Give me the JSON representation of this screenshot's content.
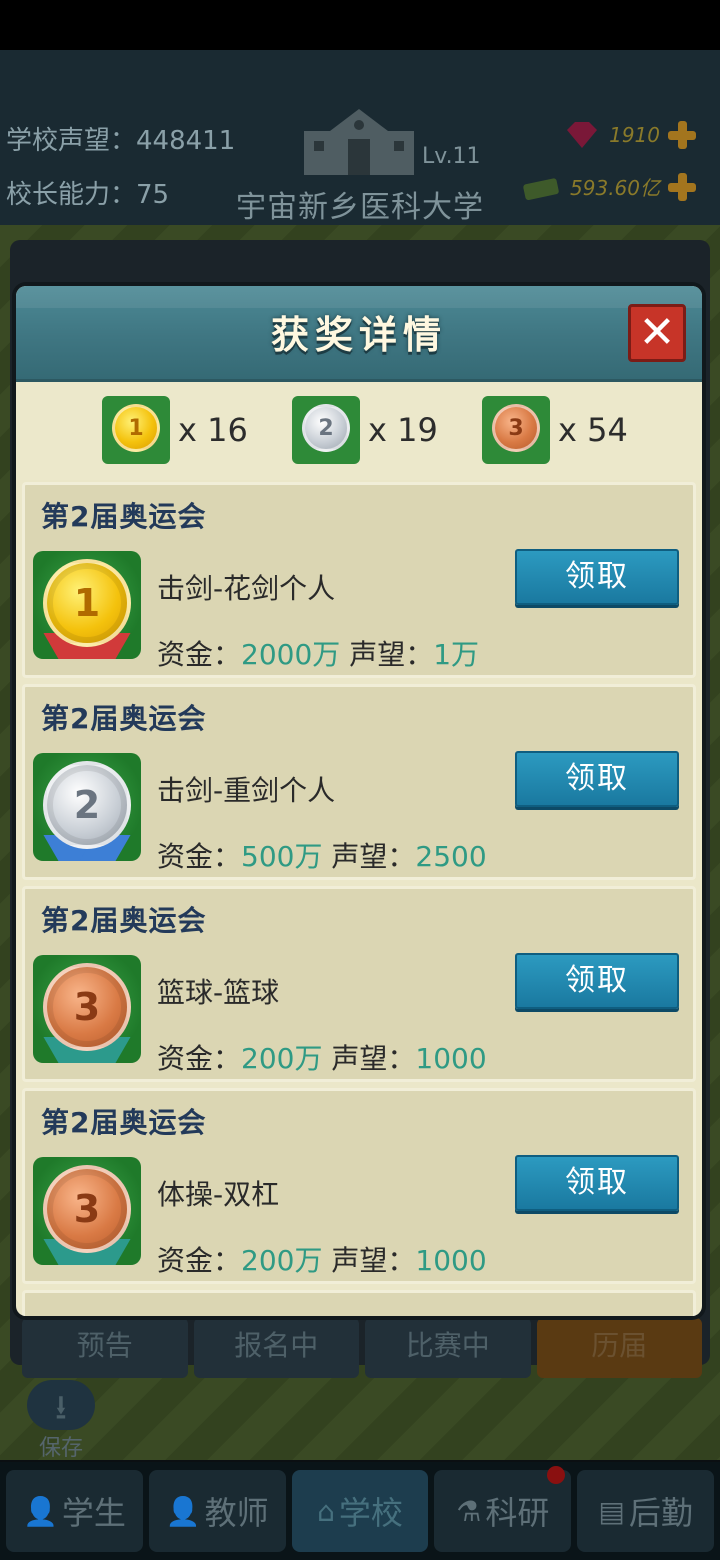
{
  "hud": {
    "reputation_label": "学校声望：",
    "reputation_value": "448411",
    "ability_label": "校长能力：",
    "ability_value": "75",
    "school_level": "Lv.11",
    "school_name": "宇宙新乡医科大学",
    "gems": "1910",
    "money": "593.60亿"
  },
  "background_tabs": [
    "预告",
    "报名中",
    "比赛中",
    "历届"
  ],
  "save_label": "保存",
  "bottom_nav": [
    "学生",
    "教师",
    "学校",
    "科研",
    "后勤"
  ],
  "modal": {
    "title": "获奖详情",
    "close_glyph": "✕",
    "summary": {
      "gold_count": "x 16",
      "silver_count": "x 19",
      "bronze_count": "x 54"
    },
    "awards": [
      {
        "event": "第2届奥运会",
        "medal": "1",
        "name": "击剑-花剑个人",
        "funds_label": "资金：",
        "funds": "2000万",
        "rep_label": "声望：",
        "rep": "1万",
        "claim": "领取"
      },
      {
        "event": "第2届奥运会",
        "medal": "2",
        "name": "击剑-重剑个人",
        "funds_label": "资金：",
        "funds": "500万",
        "rep_label": "声望：",
        "rep": "2500",
        "claim": "领取"
      },
      {
        "event": "第2届奥运会",
        "medal": "3",
        "name": "篮球-篮球",
        "funds_label": "资金：",
        "funds": "200万",
        "rep_label": "声望：",
        "rep": "1000",
        "claim": "领取"
      },
      {
        "event": "第2届奥运会",
        "medal": "3",
        "name": "体操-双杠",
        "funds_label": "资金：",
        "funds": "200万",
        "rep_label": "声望：",
        "rep": "1000",
        "claim": "领取"
      }
    ]
  },
  "colors": {
    "header": "#3f7682",
    "claim_button": "#1a79a0",
    "close_button": "#c73428",
    "value_text": "#2f9a84"
  }
}
